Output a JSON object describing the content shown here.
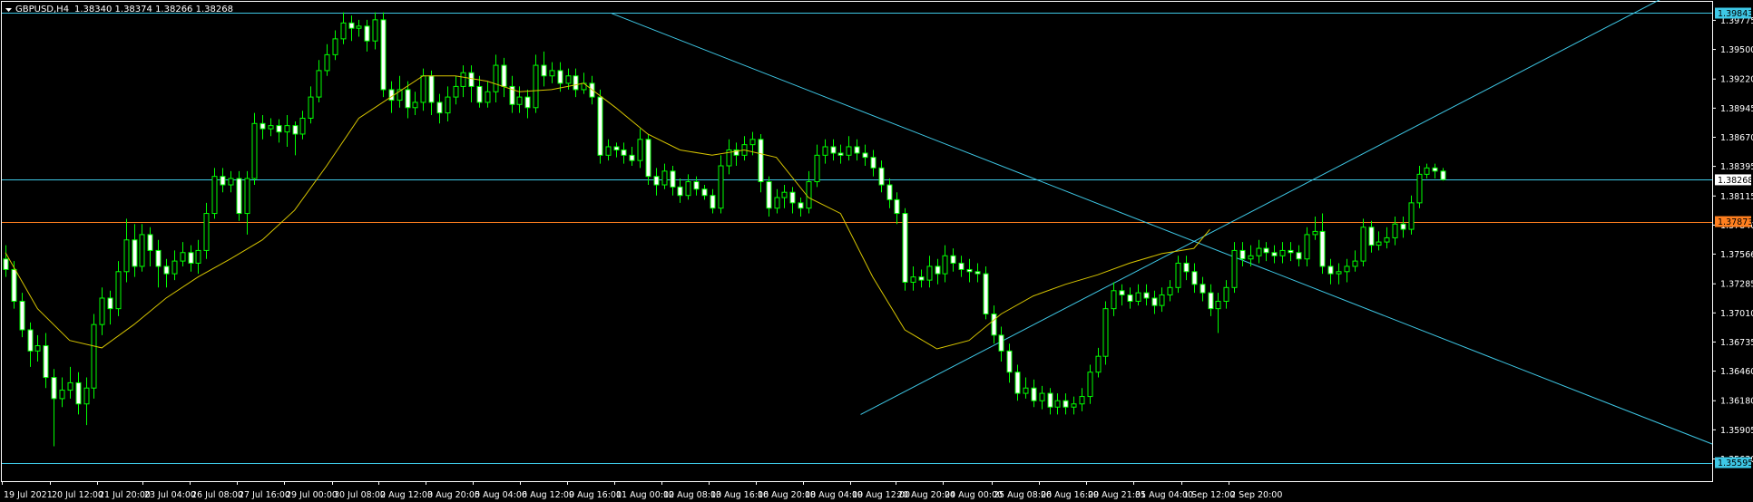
{
  "header": {
    "symbol_timeframe": "GBPUSD,H4",
    "ohlc": "1.38340 1.38374 1.38266 1.38268"
  },
  "colors": {
    "background": "#000000",
    "frame": "#ffffff",
    "bull_candle": "#ffffff",
    "bear_candle": "#000000",
    "candle_outline": "#00ff00",
    "moving_average": "#d7c500",
    "trendline": "#3ec8e6",
    "horizontal_line_cyan": "#3ec8e6",
    "horizontal_line_orange": "#ff7f1f",
    "tag_cyan": "#3ec8e6",
    "tag_orange": "#ff7f1f"
  },
  "chart_data": {
    "type": "candlestick",
    "symbol": "GBPUSD",
    "timeframe": "H4",
    "ylim": [
      1.3542,
      1.3995
    ],
    "y_ticks": [
      "1.39775",
      "1.39500",
      "1.39220",
      "1.38945",
      "1.38670",
      "1.38395",
      "1.38115",
      "1.37840",
      "1.37566",
      "1.37285",
      "1.37010",
      "1.36735",
      "1.36460",
      "1.36180",
      "1.35905",
      "1.35630"
    ],
    "x_ticks": [
      "19 Jul 2021",
      "20 Jul 12:00",
      "21 Jul 20:00",
      "23 Jul 04:00",
      "26 Jul 08:00",
      "27 Jul 16:00",
      "29 Jul 00:00",
      "30 Jul 08:00",
      "2 Aug 12:00",
      "3 Aug 20:00",
      "5 Aug 04:00",
      "6 Aug 12:00",
      "9 Aug 16:00",
      "11 Aug 00:00",
      "12 Aug 08:00",
      "13 Aug 16:00",
      "16 Aug 20:00",
      "18 Aug 04:00",
      "19 Aug 12:00",
      "20 Aug 20:00",
      "24 Aug 00:00",
      "25 Aug 08:00",
      "26 Aug 16:00",
      "29 Aug 21:05",
      "31 Aug 04:00",
      "1 Sep 12:00",
      "2 Sep 20:00"
    ],
    "horizontal_levels": [
      {
        "price": 1.39843,
        "label": "1.39843",
        "color": "cyan"
      },
      {
        "price": 1.38268,
        "label": "1.38268",
        "color": "cyan"
      },
      {
        "price": 1.37873,
        "label": "1.37873",
        "color": "orange"
      },
      {
        "price": 1.35595,
        "label": "1.35595",
        "color": "cyan"
      }
    ],
    "trendlines": [
      {
        "name": "descending",
        "x": [
          75.5,
          156
        ],
        "y": [
          1.3984,
          1.3745
        ]
      },
      {
        "name": "ascending",
        "x": [
          106.5,
          156
        ],
        "y": [
          1.3605,
          1.38
        ]
      }
    ],
    "ma_x": [
      0,
      4,
      8,
      12,
      16,
      20,
      24,
      28,
      32,
      36,
      40,
      44,
      48,
      52,
      56,
      60,
      64,
      68,
      72,
      76,
      80,
      84,
      88,
      92,
      96,
      100,
      104,
      108,
      112,
      116,
      120,
      124,
      128,
      132,
      136,
      140,
      144,
      148,
      150
    ],
    "ma_y": [
      1.3758,
      1.3705,
      1.3675,
      1.3668,
      1.369,
      1.3715,
      1.3735,
      1.3752,
      1.377,
      1.3798,
      1.384,
      1.3885,
      1.3905,
      1.3925,
      1.3925,
      1.392,
      1.391,
      1.3912,
      1.3918,
      1.3895,
      1.387,
      1.3855,
      1.385,
      1.3855,
      1.3848,
      1.381,
      1.3795,
      1.3735,
      1.3685,
      1.3667,
      1.3675,
      1.37,
      1.3717,
      1.3728,
      1.3737,
      1.3748,
      1.3757,
      1.3762,
      1.378
    ],
    "candles": [
      [
        1.3752,
        1.3742,
        1.3765,
        1.3735
      ],
      [
        1.3742,
        1.3712,
        1.375,
        1.3705
      ],
      [
        1.3712,
        1.3685,
        1.372,
        1.3678
      ],
      [
        1.3685,
        1.3665,
        1.3692,
        1.365
      ],
      [
        1.3665,
        1.367,
        1.368,
        1.3655
      ],
      [
        1.367,
        1.364,
        1.3682,
        1.363
      ],
      [
        1.364,
        1.362,
        1.3648,
        1.3575
      ],
      [
        1.362,
        1.3628,
        1.364,
        1.3612
      ],
      [
        1.3628,
        1.3635,
        1.365,
        1.362
      ],
      [
        1.3635,
        1.3615,
        1.3645,
        1.3605
      ],
      [
        1.3615,
        1.363,
        1.364,
        1.3595
      ],
      [
        1.363,
        1.369,
        1.37,
        1.362
      ],
      [
        1.369,
        1.3715,
        1.3725,
        1.368
      ],
      [
        1.3715,
        1.3705,
        1.3722,
        1.369
      ],
      [
        1.3705,
        1.374,
        1.375,
        1.3698
      ],
      [
        1.374,
        1.377,
        1.379,
        1.373
      ],
      [
        1.377,
        1.3745,
        1.3785,
        1.3735
      ],
      [
        1.3745,
        1.3775,
        1.3785,
        1.374
      ],
      [
        1.3775,
        1.376,
        1.3782,
        1.3745
      ],
      [
        1.376,
        1.3745,
        1.377,
        1.3725
      ],
      [
        1.3745,
        1.3738,
        1.3752,
        1.3725
      ],
      [
        1.3738,
        1.375,
        1.376,
        1.3732
      ],
      [
        1.375,
        1.3758,
        1.3768,
        1.3745
      ],
      [
        1.3758,
        1.3748,
        1.3765,
        1.374
      ],
      [
        1.3748,
        1.376,
        1.377,
        1.3738
      ],
      [
        1.376,
        1.3795,
        1.3805,
        1.3752
      ],
      [
        1.3795,
        1.383,
        1.3838,
        1.379
      ],
      [
        1.383,
        1.3822,
        1.3838,
        1.3815
      ],
      [
        1.3822,
        1.3828,
        1.3835,
        1.3815
      ],
      [
        1.3828,
        1.3795,
        1.3835,
        1.3788
      ],
      [
        1.3795,
        1.3828,
        1.3835,
        1.3775
      ],
      [
        1.3828,
        1.388,
        1.389,
        1.3822
      ],
      [
        1.388,
        1.3875,
        1.3888,
        1.3865
      ],
      [
        1.3875,
        1.3878,
        1.3885,
        1.3868
      ],
      [
        1.3878,
        1.3872,
        1.3884,
        1.3862
      ],
      [
        1.3872,
        1.3878,
        1.3888,
        1.3858
      ],
      [
        1.3878,
        1.387,
        1.3882,
        1.385
      ],
      [
        1.387,
        1.3885,
        1.3892,
        1.3865
      ],
      [
        1.3885,
        1.3905,
        1.3915,
        1.388
      ],
      [
        1.3905,
        1.393,
        1.394,
        1.39
      ],
      [
        1.393,
        1.3945,
        1.3955,
        1.3925
      ],
      [
        1.3945,
        1.396,
        1.3968,
        1.394
      ],
      [
        1.396,
        1.3975,
        1.3985,
        1.3955
      ],
      [
        1.3975,
        1.397,
        1.3982,
        1.3958
      ],
      [
        1.397,
        1.3972,
        1.3978,
        1.3962
      ],
      [
        1.3972,
        1.3958,
        1.3978,
        1.3948
      ],
      [
        1.3958,
        1.3978,
        1.3985,
        1.395
      ],
      [
        1.3978,
        1.3912,
        1.3985,
        1.3905
      ],
      [
        1.3912,
        1.3902,
        1.392,
        1.389
      ],
      [
        1.3902,
        1.3912,
        1.3925,
        1.3895
      ],
      [
        1.3912,
        1.3895,
        1.392,
        1.3885
      ],
      [
        1.3895,
        1.39,
        1.391,
        1.3888
      ],
      [
        1.39,
        1.3925,
        1.3932,
        1.3892
      ],
      [
        1.3925,
        1.39,
        1.393,
        1.3888
      ],
      [
        1.39,
        1.389,
        1.3908,
        1.388
      ],
      [
        1.389,
        1.3905,
        1.3915,
        1.3882
      ],
      [
        1.3905,
        1.3915,
        1.3925,
        1.3898
      ],
      [
        1.3915,
        1.3928,
        1.3935,
        1.3905
      ],
      [
        1.3928,
        1.3915,
        1.3935,
        1.39
      ],
      [
        1.3915,
        1.39,
        1.3925,
        1.3895
      ],
      [
        1.39,
        1.391,
        1.392,
        1.3895
      ],
      [
        1.391,
        1.3935,
        1.3945,
        1.39
      ],
      [
        1.3935,
        1.3915,
        1.3942,
        1.3905
      ],
      [
        1.3915,
        1.3898,
        1.3925,
        1.389
      ],
      [
        1.3898,
        1.3905,
        1.3915,
        1.389
      ],
      [
        1.3905,
        1.3895,
        1.3912,
        1.3885
      ],
      [
        1.3895,
        1.3935,
        1.3945,
        1.389
      ],
      [
        1.3935,
        1.3925,
        1.3948,
        1.3915
      ],
      [
        1.3925,
        1.393,
        1.3938,
        1.3918
      ],
      [
        1.393,
        1.3918,
        1.3938,
        1.391
      ],
      [
        1.3918,
        1.3925,
        1.3932,
        1.3912
      ],
      [
        1.3925,
        1.3912,
        1.3932,
        1.3905
      ],
      [
        1.3912,
        1.3918,
        1.3928,
        1.3908
      ],
      [
        1.3918,
        1.3905,
        1.3925,
        1.3898
      ],
      [
        1.3905,
        1.385,
        1.3912,
        1.3842
      ],
      [
        1.385,
        1.3858,
        1.3865,
        1.3845
      ],
      [
        1.3858,
        1.3855,
        1.3862,
        1.3848
      ],
      [
        1.3855,
        1.385,
        1.3862,
        1.3842
      ],
      [
        1.385,
        1.3845,
        1.3858,
        1.384
      ],
      [
        1.3845,
        1.3865,
        1.3875,
        1.3838
      ],
      [
        1.3865,
        1.383,
        1.387,
        1.3822
      ],
      [
        1.383,
        1.3822,
        1.3838,
        1.3812
      ],
      [
        1.3822,
        1.3835,
        1.3842,
        1.3818
      ],
      [
        1.3835,
        1.382,
        1.384,
        1.3812
      ],
      [
        1.382,
        1.3812,
        1.3828,
        1.3805
      ],
      [
        1.3812,
        1.3825,
        1.3832,
        1.3808
      ],
      [
        1.3825,
        1.3818,
        1.383,
        1.3812
      ],
      [
        1.3818,
        1.3812,
        1.3822,
        1.3808
      ],
      [
        1.3812,
        1.38,
        1.3818,
        1.3795
      ],
      [
        1.38,
        1.384,
        1.385,
        1.3795
      ],
      [
        1.384,
        1.3855,
        1.3865,
        1.3832
      ],
      [
        1.3855,
        1.385,
        1.3862,
        1.384
      ],
      [
        1.385,
        1.386,
        1.3868,
        1.3845
      ],
      [
        1.386,
        1.3865,
        1.3872,
        1.385
      ],
      [
        1.3865,
        1.3825,
        1.387,
        1.3815
      ],
      [
        1.3825,
        1.38,
        1.383,
        1.3792
      ],
      [
        1.38,
        1.381,
        1.3818,
        1.3795
      ],
      [
        1.381,
        1.3815,
        1.3822,
        1.38
      ],
      [
        1.3815,
        1.3805,
        1.382,
        1.3795
      ],
      [
        1.3805,
        1.38,
        1.381,
        1.3792
      ],
      [
        1.38,
        1.3825,
        1.3835,
        1.3795
      ],
      [
        1.3825,
        1.385,
        1.386,
        1.382
      ],
      [
        1.385,
        1.3858,
        1.3865,
        1.3842
      ],
      [
        1.3858,
        1.3852,
        1.3865,
        1.3845
      ],
      [
        1.3852,
        1.385,
        1.386,
        1.3842
      ],
      [
        1.385,
        1.3858,
        1.3868,
        1.3845
      ],
      [
        1.3858,
        1.3852,
        1.3865,
        1.3845
      ],
      [
        1.3852,
        1.3848,
        1.386,
        1.384
      ],
      [
        1.3848,
        1.3838,
        1.3855,
        1.383
      ],
      [
        1.3838,
        1.3822,
        1.3845,
        1.3815
      ],
      [
        1.3822,
        1.3808,
        1.3828,
        1.38
      ],
      [
        1.3808,
        1.3795,
        1.3815,
        1.3785
      ],
      [
        1.3795,
        1.373,
        1.38,
        1.3722
      ],
      [
        1.373,
        1.3735,
        1.3745,
        1.3722
      ],
      [
        1.3735,
        1.3732,
        1.3742,
        1.3725
      ],
      [
        1.3732,
        1.3745,
        1.3755,
        1.3725
      ],
      [
        1.3745,
        1.3738,
        1.3752,
        1.3728
      ],
      [
        1.3738,
        1.3755,
        1.3765,
        1.373
      ],
      [
        1.3755,
        1.3748,
        1.3762,
        1.374
      ],
      [
        1.3748,
        1.3742,
        1.3755,
        1.3735
      ],
      [
        1.3742,
        1.374,
        1.3752,
        1.373
      ],
      [
        1.374,
        1.3738,
        1.3748,
        1.373
      ],
      [
        1.3738,
        1.37,
        1.3745,
        1.3695
      ],
      [
        1.37,
        1.368,
        1.3708,
        1.3672
      ],
      [
        1.368,
        1.3665,
        1.3688,
        1.3655
      ],
      [
        1.3665,
        1.3645,
        1.3672,
        1.3635
      ],
      [
        1.3645,
        1.3625,
        1.3652,
        1.3618
      ],
      [
        1.3625,
        1.363,
        1.364,
        1.362
      ],
      [
        1.363,
        1.3618,
        1.3638,
        1.3612
      ],
      [
        1.3618,
        1.3625,
        1.3632,
        1.361
      ],
      [
        1.3625,
        1.3612,
        1.363,
        1.3605
      ],
      [
        1.3612,
        1.3618,
        1.3625,
        1.3605
      ],
      [
        1.3618,
        1.3612,
        1.3625,
        1.3605
      ],
      [
        1.3612,
        1.3615,
        1.3622,
        1.3605
      ],
      [
        1.3615,
        1.3622,
        1.363,
        1.3608
      ],
      [
        1.3622,
        1.3645,
        1.3652,
        1.3615
      ],
      [
        1.3645,
        1.366,
        1.3668,
        1.364
      ],
      [
        1.366,
        1.3705,
        1.3712,
        1.3652
      ],
      [
        1.3705,
        1.3722,
        1.373,
        1.3698
      ],
      [
        1.3722,
        1.3718,
        1.3728,
        1.3708
      ],
      [
        1.3718,
        1.3712,
        1.3725,
        1.3705
      ],
      [
        1.3712,
        1.372,
        1.3728,
        1.3708
      ],
      [
        1.372,
        1.3715,
        1.3728,
        1.3708
      ],
      [
        1.3715,
        1.3708,
        1.3722,
        1.37
      ],
      [
        1.3708,
        1.3718,
        1.3725,
        1.3702
      ],
      [
        1.3718,
        1.3725,
        1.3732,
        1.3712
      ],
      [
        1.3725,
        1.3748,
        1.3755,
        1.372
      ],
      [
        1.3748,
        1.374,
        1.3755,
        1.3732
      ],
      [
        1.374,
        1.3728,
        1.3748,
        1.372
      ],
      [
        1.3728,
        1.372,
        1.3735,
        1.3712
      ],
      [
        1.372,
        1.3705,
        1.3728,
        1.3698
      ],
      [
        1.3705,
        1.3712,
        1.372,
        1.3682
      ],
      [
        1.3712,
        1.3725,
        1.3732,
        1.3705
      ],
      [
        1.3725,
        1.376,
        1.3768,
        1.372
      ],
      [
        1.376,
        1.3752,
        1.3768,
        1.3745
      ],
      [
        1.3752,
        1.3755,
        1.3765,
        1.3745
      ],
      [
        1.3755,
        1.3762,
        1.377,
        1.3748
      ],
      [
        1.3762,
        1.3758,
        1.3768,
        1.375
      ],
      [
        1.3758,
        1.3755,
        1.3765,
        1.3748
      ],
      [
        1.3755,
        1.376,
        1.3768,
        1.3748
      ],
      [
        1.376,
        1.3758,
        1.3768,
        1.375
      ],
      [
        1.3758,
        1.3752,
        1.3765,
        1.3745
      ],
      [
        1.3752,
        1.3775,
        1.3782,
        1.3745
      ],
      [
        1.3775,
        1.3778,
        1.3792,
        1.377
      ],
      [
        1.3778,
        1.3745,
        1.3795,
        1.3738
      ],
      [
        1.3745,
        1.3738,
        1.3752,
        1.3728
      ],
      [
        1.3738,
        1.374,
        1.3748,
        1.3728
      ],
      [
        1.374,
        1.3745,
        1.3752,
        1.373
      ],
      [
        1.3745,
        1.375,
        1.376,
        1.374
      ],
      [
        1.375,
        1.3782,
        1.379,
        1.3745
      ],
      [
        1.3782,
        1.3765,
        1.3788,
        1.3758
      ],
      [
        1.3765,
        1.3768,
        1.3778,
        1.376
      ],
      [
        1.3768,
        1.3772,
        1.3782,
        1.3762
      ],
      [
        1.3772,
        1.3785,
        1.3792,
        1.3765
      ],
      [
        1.3785,
        1.378,
        1.3792,
        1.3772
      ],
      [
        1.378,
        1.3805,
        1.3812,
        1.3775
      ],
      [
        1.3805,
        1.3832,
        1.384,
        1.38
      ],
      [
        1.3832,
        1.3838,
        1.3842,
        1.3828
      ],
      [
        1.3838,
        1.3835,
        1.3842,
        1.3828
      ],
      [
        1.3835,
        1.3827,
        1.3838,
        1.3826
      ]
    ]
  },
  "price_tags": {
    "top": "1.39843",
    "current": "1.38268",
    "orange": "1.37873",
    "bottom": "1.35595"
  }
}
